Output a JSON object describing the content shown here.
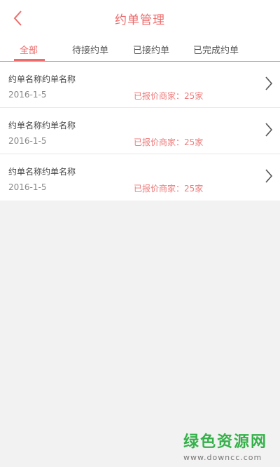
{
  "header": {
    "title": "约单管理"
  },
  "tabs": [
    {
      "label": "全部",
      "active": true
    },
    {
      "label": "待接约单",
      "active": false
    },
    {
      "label": "已接约单",
      "active": false
    },
    {
      "label": "已完成约单",
      "active": false
    }
  ],
  "orders": [
    {
      "name": "约单名称约单名称",
      "date": "2016-1-5",
      "quote": "已报价商家：25家"
    },
    {
      "name": "约单名称约单名称",
      "date": "2016-1-5",
      "quote": "已报价商家：25家"
    },
    {
      "name": "约单名称约单名称",
      "date": "2016-1-5",
      "quote": "已报价商家：25家"
    }
  ],
  "watermark": {
    "main": "绿色资源网",
    "url": "www.downcc.com"
  },
  "colors": {
    "accent": "#ee6b6b",
    "watermark": "#35b14a",
    "background": "#f2f2f2"
  },
  "icons": {
    "back": "chevron-left-icon",
    "item_arrow": "chevron-right-icon"
  }
}
